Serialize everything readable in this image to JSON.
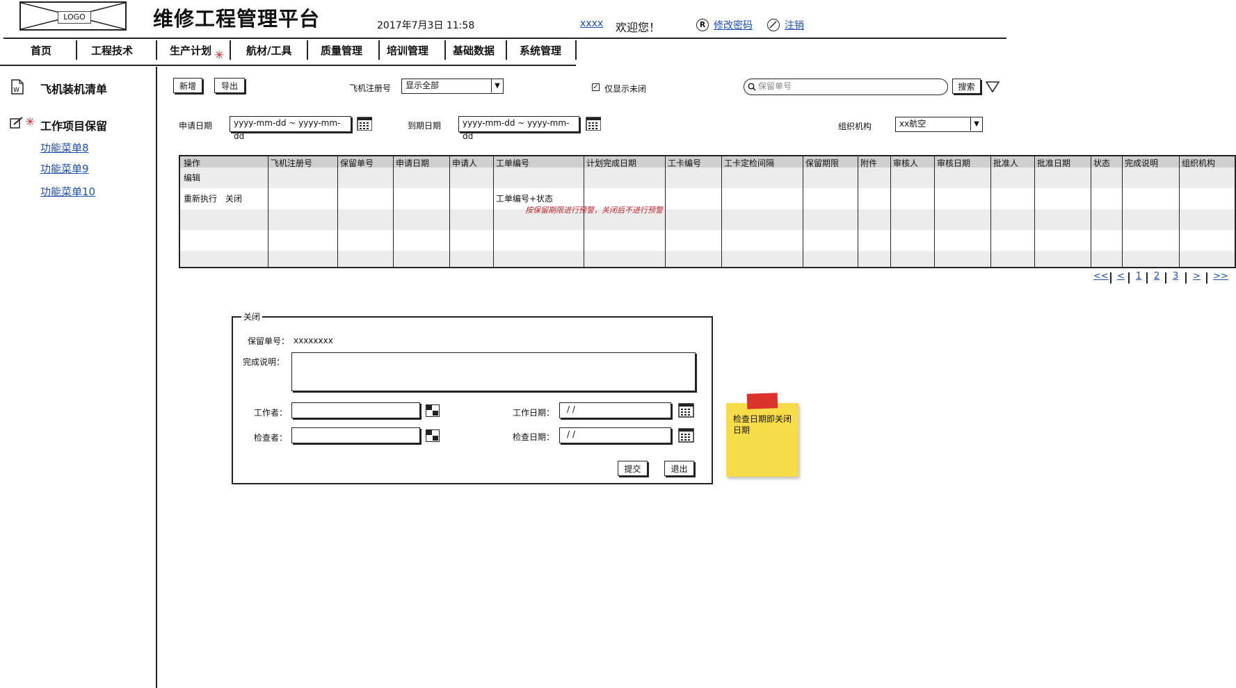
{
  "header": {
    "logo_text": "LOGO",
    "title": "维修工程管理平台",
    "datetime": "2017年7月3日  11:58",
    "username": "xxxx",
    "welcome": "欢迎您！",
    "change_password": "修改密码",
    "logout": "注销"
  },
  "nav": {
    "items": [
      {
        "label": "首页"
      },
      {
        "label": "工程技术"
      },
      {
        "label": "生产计划"
      },
      {
        "label": "航材/工具"
      },
      {
        "label": "质量管理"
      },
      {
        "label": "培训管理"
      },
      {
        "label": "基础数据"
      },
      {
        "label": "系统管理"
      }
    ],
    "marker": "✳"
  },
  "sidebar": {
    "section1": "飞机装机清单",
    "section2": "工作项目保留",
    "marker": "✳",
    "links": [
      "功能菜单8",
      "功能菜单9",
      "功能菜单10"
    ]
  },
  "toolbar": {
    "add": "新增",
    "export": "导出",
    "reg_label": "飞机注册号",
    "reg_value": "显示全部",
    "unclosed_label": "仅显示未闭",
    "unclosed_checked": "✓",
    "search_placeholder": "保留单号",
    "search_button": "搜索",
    "apply_date_label": "申请日期",
    "apply_date_value": "yyyy-mm-dd ~ yyyy-mm-dd",
    "due_date_label": "到期日期",
    "due_date_value": "yyyy-mm-dd ~ yyyy-mm-dd",
    "org_label": "组织机构",
    "org_value": "xx航空"
  },
  "table": {
    "columns": [
      "操作",
      "飞机注册号",
      "保留单号",
      "申请日期",
      "申请人",
      "工单编号",
      "计划完成日期",
      "工卡编号",
      "工卡定检间隔",
      "保留期限",
      "附件",
      "审核人",
      "审核日期",
      "批准人",
      "批准日期",
      "状态",
      "完成说明",
      "组织机构"
    ],
    "row1_action": "编辑",
    "row2_actions": [
      "重新执行",
      "关闭"
    ],
    "row2_workorder": "工单编号+状态",
    "warning": "按保留期限进行预警，关闭后不进行预警"
  },
  "pager": [
    "<<",
    "<",
    "1",
    "2",
    "3",
    ">",
    ">>"
  ],
  "dialog": {
    "title": "关闭",
    "keep_no_label": "保留单号：",
    "keep_no_value": "xxxxxxxx",
    "completion_label": "完成说明：",
    "worker_label": "工作者：",
    "work_date_label": "工作日期：",
    "work_date_value": "/   /",
    "inspector_label": "检查者：",
    "inspect_date_label": "检查日期：",
    "inspect_date_value": "/   /",
    "submit": "提交",
    "exit": "退出"
  },
  "note": {
    "text": "检查日期即关闭日期"
  }
}
